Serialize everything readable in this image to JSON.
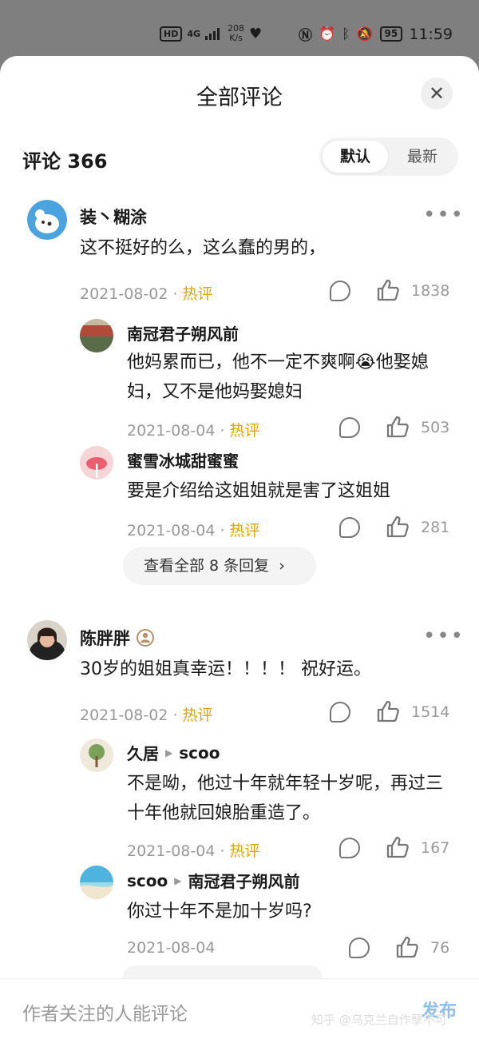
{
  "status_bar": {
    "hd": "HD",
    "net": "4G",
    "speed_value": "208",
    "speed_unit": "K/s",
    "battery": "95",
    "time": "11:59"
  },
  "sheet": {
    "title": "全部评论",
    "close_label": "✕",
    "comment_count": "评论 366",
    "sort": {
      "default": "默认",
      "newest": "最新"
    }
  },
  "threads": [
    {
      "author": "装丶糊涂",
      "text": "这不挺好的么，这么蠢的男的，",
      "date": "2021-08-02",
      "hot": "热评",
      "likes": "1838",
      "replies": [
        {
          "author": "南冠君子朔风前",
          "text": "他妈累而已，他不一定不爽啊😭他娶媳妇，又不是他妈娶媳妇",
          "date": "2021-08-04",
          "hot": "热评",
          "likes": "503"
        },
        {
          "author": "蜜雪冰城甜蜜蜜",
          "text": "要是介绍给这姐姐就是害了这姐姐",
          "date": "2021-08-04",
          "hot": "热评",
          "likes": "281"
        }
      ],
      "view_all": "查看全部 8 条回复"
    },
    {
      "author": "陈胖胖",
      "text": "30岁的姐姐真幸运！！！！ 祝好运。",
      "date": "2021-08-02",
      "hot": "热评",
      "likes": "1514",
      "replies": [
        {
          "author": "久居",
          "reply_to": "scoo",
          "text": "不是呦，他过十年就年轻十岁呢，再过三十年他就回娘胎重造了。",
          "date": "2021-08-04",
          "hot": "热评",
          "likes": "167"
        },
        {
          "author": "scoo",
          "reply_to": "南冠君子朔风前",
          "text": "你过十年不是加十岁吗?",
          "date": "2021-08-04",
          "likes": "76"
        }
      ]
    }
  ],
  "bottom": {
    "placeholder": "作者关注的人能评论",
    "publish": "发布",
    "watermark": "知乎 @乌克兰自作孽不可"
  },
  "colors": {
    "hot": "#e6a400",
    "publish": "#8fbdf3",
    "overlay": "#7f7f7f"
  },
  "icons": [
    "more-icon",
    "reply-icon",
    "like-icon",
    "close-icon",
    "chevron-right-icon",
    "crown-badge-icon"
  ]
}
